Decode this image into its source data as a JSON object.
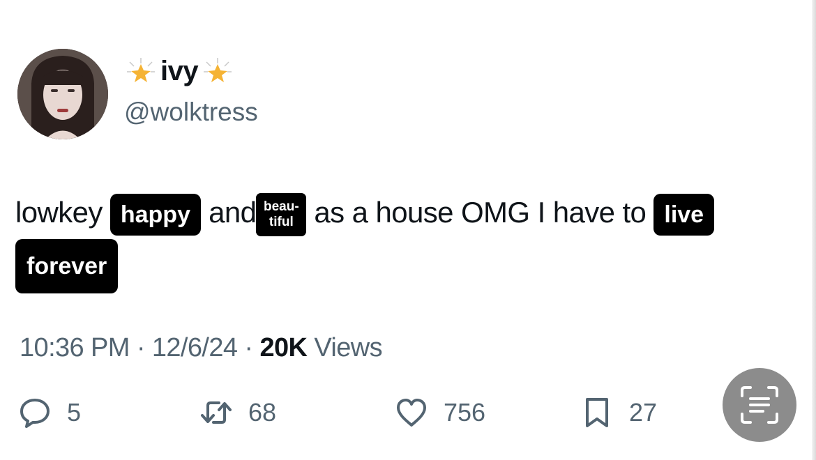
{
  "tweet": {
    "author": {
      "display_name": "ivy",
      "handle": "@wolktress"
    },
    "text": {
      "w1": "lowkey",
      "tag_happy": "happy",
      "w2": "and",
      "tag_beautiful_1": "beau-",
      "tag_beautiful_2": "tiful",
      "w3": "as a house OMG I have to",
      "tag_live": "live",
      "tag_forever": "forever"
    },
    "meta": {
      "time": "10:36 PM",
      "date": "12/6/24",
      "views_count": "20K",
      "views_label": "Views",
      "sep": "·"
    },
    "actions": {
      "replies": "5",
      "reposts": "68",
      "likes": "756",
      "bookmarks": "27"
    }
  },
  "colors": {
    "text_primary": "#0f1419",
    "text_secondary": "#536471",
    "tag_bg": "#000000",
    "scan_button_bg": "#8c8c8c"
  },
  "icons": [
    "star-icon",
    "reply-icon",
    "repost-icon",
    "like-icon",
    "bookmark-icon",
    "text-scan-icon"
  ]
}
